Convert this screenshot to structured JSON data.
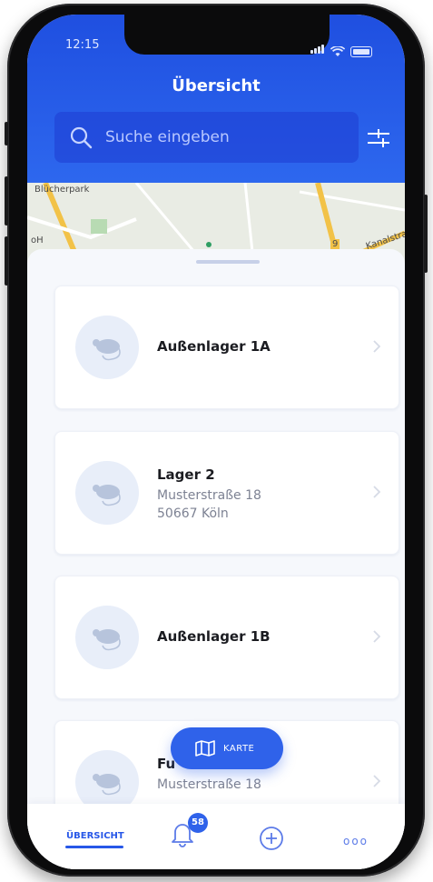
{
  "status": {
    "time": "12:15"
  },
  "header": {
    "title": "Übersicht"
  },
  "search": {
    "placeholder": "Suche eingeben"
  },
  "map": {
    "labels": [
      "Blücherpark",
      "oH",
      "Kanalstraße",
      "9"
    ]
  },
  "cards": [
    {
      "title": "Außenlager 1A",
      "street": "",
      "city": ""
    },
    {
      "title": "Lager 2",
      "street": "Musterstraße 18",
      "city": "50667 Köln"
    },
    {
      "title": "Außenlager 1B",
      "street": "",
      "city": ""
    },
    {
      "title": "Fu",
      "street": "Musterstraße 18",
      "city": ""
    }
  ],
  "fab": {
    "label": "KARTE"
  },
  "tabbar": {
    "overview": "ÜBERSICHT",
    "badge": "58",
    "more": "ooo"
  },
  "colors": {
    "primary": "#2f62ea",
    "header_top": "#1f4fe0",
    "background": "#f6f8fc"
  }
}
